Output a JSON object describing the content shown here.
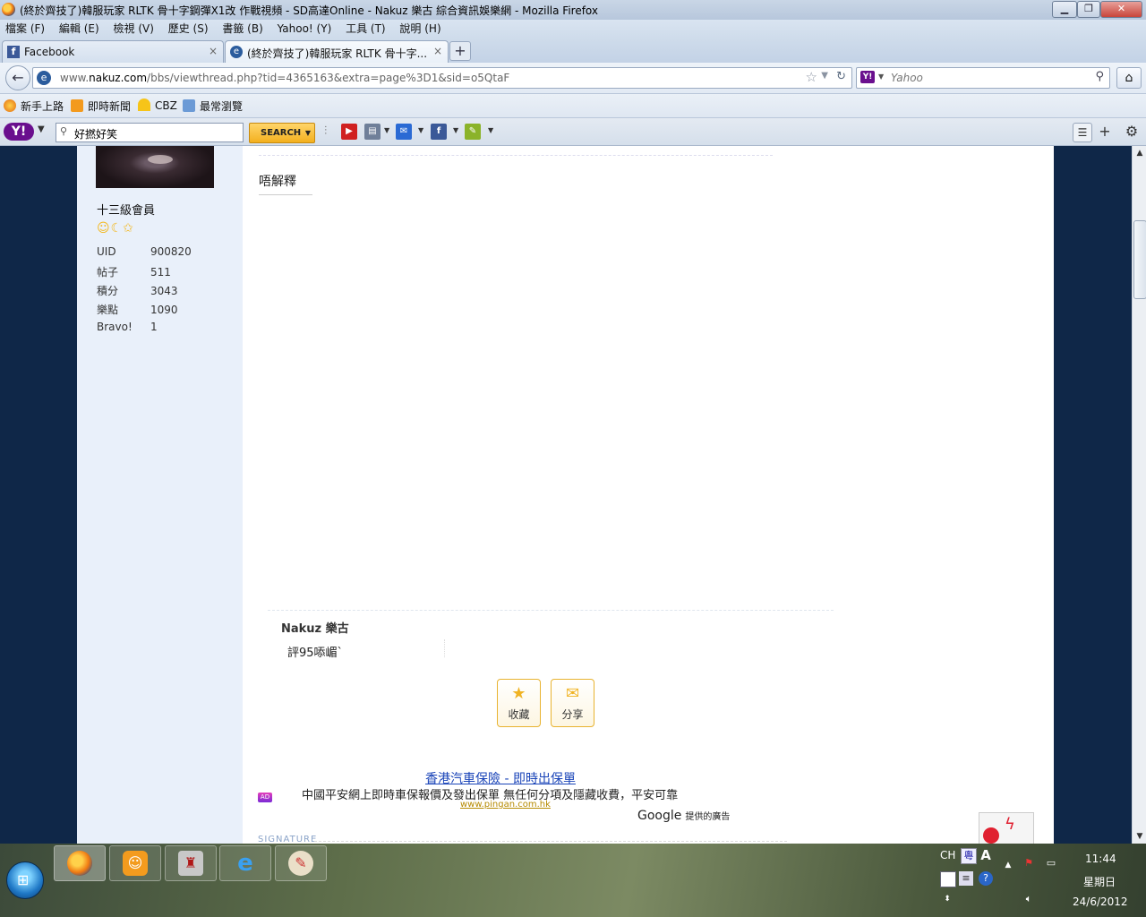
{
  "window": {
    "title": "(終於齊技了)韓服玩家 RLTK 骨十字鋼彈X1改 作戰視頻 - SD高達Online - Nakuz 樂古 綜合資訊娛樂網 - Mozilla Firefox"
  },
  "menu": [
    "檔案 (F)",
    "編輯 (E)",
    "檢視 (V)",
    "歷史 (S)",
    "書籤 (B)",
    "Yahoo! (Y)",
    "工具 (T)",
    "說明 (H)"
  ],
  "tabs": [
    {
      "label": "Facebook",
      "close": "×"
    },
    {
      "label": "(終於齊技了)韓服玩家 RLTK 骨十字...",
      "close": "×"
    }
  ],
  "newtab": "+",
  "nav": {
    "url_prefix": "www.",
    "url_domain": "nakuz.com",
    "url_path": "/bbs/viewthread.php?tid=4365163&extra=page%3D1&sid=o5QtaF",
    "search_placeholder": "Yahoo"
  },
  "bookmarks": [
    "新手上路",
    "即時新聞",
    "CBZ",
    "最常瀏覽"
  ],
  "yahoo_toolbar": {
    "search_value": "好撚好笑",
    "search_button": "SEARCH"
  },
  "sidebar": {
    "rank": "十三級會員",
    "stats": [
      {
        "k": "UID",
        "v": "900820"
      },
      {
        "k": "帖子",
        "v": "511"
      },
      {
        "k": "積分",
        "v": "3043"
      },
      {
        "k": "樂點",
        "v": "1090"
      },
      {
        "k": "Bravo!",
        "v": "1"
      }
    ]
  },
  "post": {
    "text": "唔解釋"
  },
  "rating": {
    "title": "Nakuz 樂古",
    "comment": "評95㖭嵋`"
  },
  "actions": {
    "favorite": "收藏",
    "share": "分享"
  },
  "ad": {
    "title": "香港汽車保險 - 即時出保單",
    "badge": "AD",
    "desc": "中國平安網上即時車保報價及發出保單 無任何分項及隱藏收費，平安可靠",
    "url": "www.pingan.com.hk",
    "google": "Google",
    "google_note": "提供的廣告"
  },
  "signature_label": "SIGNATURE",
  "taskbar": {
    "lang": "CH",
    "time": "11:44",
    "weekday": "星期日",
    "date": "24/6/2012"
  },
  "colors": {
    "page_bg": "#0f2748",
    "sidebar_bg": "#e9f0fa",
    "link": "#1a44b8",
    "yahoo_purple": "#6a0f8e",
    "search_btn": "#f3b01f"
  }
}
